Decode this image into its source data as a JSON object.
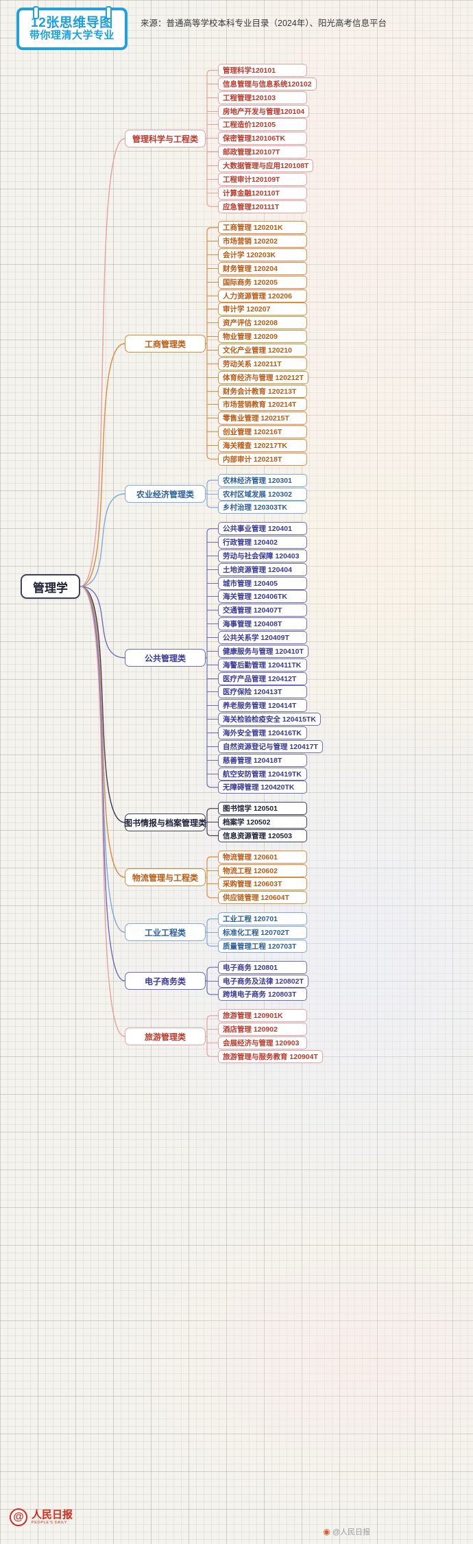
{
  "banner": {
    "line1": "12张思维导图",
    "line2": "带你理清大学专业",
    "clip_left_icon": "binder-clip-icon",
    "clip_right_icon": "binder-clip-icon"
  },
  "source": {
    "text": "来源：普通高等学校本科专业目录（2024年）、阳光高考信息平台"
  },
  "footer": {
    "logo_mark": "@",
    "logo_cn": "人民日报",
    "logo_en": "PEOPLE'S DAILY",
    "weibo_icon": "weibo-eye-icon",
    "weibo_handle": "@人民日报"
  },
  "mindmap": {
    "root": {
      "label": "管理学",
      "color": "#3f3f5a"
    },
    "branches": [
      {
        "label": "管理科学与工程类",
        "color": "#e8a0a0",
        "text_color": "#c0392b",
        "leaves": [
          "管理科学120101",
          "信息管理与信息系统120102",
          "工程管理120103",
          "房地产开发与管理120104",
          "工程造价120105",
          "保密管理120106TK",
          "邮政管理120107T",
          "大数据管理与应用120108T",
          "工程审计120109T",
          "计算金融120110T",
          "应急管理120111T"
        ]
      },
      {
        "label": "工商管理类",
        "color": "#e08a3c",
        "text_color": "#c05a12",
        "leaves": [
          "工商管理 120201K",
          "市场营销 120202",
          "会计学 120203K",
          "财务管理 120204",
          "国际商务 120205",
          "人力资源管理 120206",
          "审计学 120207",
          "资产评估 120208",
          "物业管理 120209",
          "文化产业管理 120210",
          "劳动关系 120211T",
          "体育经济与管理 120212T",
          "财务会计教育 120213T",
          "市场营销教育 120214T",
          "零售业管理 120215T",
          "创业管理 120216T",
          "海关稽查 120217TK",
          "内部审计 120218T"
        ]
      },
      {
        "label": "农业经济管理类",
        "color": "#7fa8dd",
        "text_color": "#2c5f9e",
        "leaves": [
          "农林经济管理 120301",
          "农村区域发展 120302",
          "乡村治理 120303TK"
        ]
      },
      {
        "label": "公共管理类",
        "color": "#6b6bc4",
        "text_color": "#3a3a9c",
        "leaves": [
          "公共事业管理 120401",
          "行政管理 120402",
          "劳动与社会保障 120403",
          "土地资源管理 120404",
          "城市管理 120405",
          "海关管理 120406TK",
          "交通管理 120407T",
          "海事管理 120408T",
          "公共关系学 120409T",
          "健康服务与管理 120410T",
          "海警后勤管理 120411TK",
          "医疗产品管理 120412T",
          "医疗保险 120413T",
          "养老服务管理 120414T",
          "海关检验检疫安全 120415TK",
          "海外安全管理 120416TK",
          "自然资源登记与管理 120417T",
          "慈善管理 120418T",
          "航空安防管理 120419TK",
          "无障碍管理 120420TK"
        ]
      },
      {
        "label": "图书情报与档案管理类",
        "color": "#3f3f5a",
        "text_color": "#20203a",
        "leaves": [
          "图书馆学 120501",
          "档案学 120502",
          "信息资源管理 120503"
        ]
      },
      {
        "label": "物流管理与工程类",
        "color": "#e08a3c",
        "text_color": "#c05a12",
        "leaves": [
          "物流管理 120601",
          "物流工程 120602",
          "采购管理 120603T",
          "供应链管理 120604T"
        ]
      },
      {
        "label": "工业工程类",
        "color": "#7fa8dd",
        "text_color": "#2c5f9e",
        "leaves": [
          "工业工程 120701",
          "标准化工程 120702T",
          "质量管理工程 120703T"
        ]
      },
      {
        "label": "电子商务类",
        "color": "#6b6bc4",
        "text_color": "#3a3a9c",
        "leaves": [
          "电子商务 120801",
          "电子商务及法律 120802T",
          "跨境电子商务 120803T"
        ]
      },
      {
        "label": "旅游管理类",
        "color": "#e8a0a0",
        "text_color": "#c0392b",
        "leaves": [
          "旅游管理 120901K",
          "酒店管理 120902",
          "会展经济与管理 120903",
          "旅游管理与服务教育 120904T"
        ]
      }
    ]
  }
}
